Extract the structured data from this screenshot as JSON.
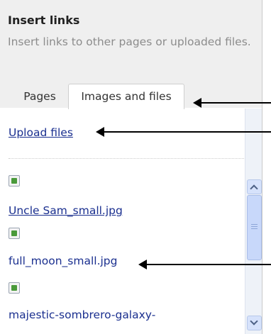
{
  "panel": {
    "title": "Insert links",
    "description": "Insert links to other pages or uploaded files."
  },
  "tabs": [
    {
      "label": "Pages",
      "active": false
    },
    {
      "label": "Images and files",
      "active": true
    }
  ],
  "list": {
    "upload_label": "Upload files",
    "items": [
      {
        "name": "Uncle Sam_small.jpg",
        "style": "linked"
      },
      {
        "name": "full_moon_small.jpg",
        "style": "plain"
      },
      {
        "name": "majestic-sombrero-galaxy-",
        "style": "plain"
      }
    ]
  },
  "icons": {
    "thumbnail": "image-file-icon",
    "scroll_up": "chevron-up-icon",
    "scroll_down": "chevron-down-icon",
    "pointer": "arrow-left-icon"
  },
  "colors": {
    "link": "#1a2f8f",
    "header_bg": "#efefef",
    "description": "#8c8c8c",
    "scrollbar": "#c8d8fa"
  }
}
